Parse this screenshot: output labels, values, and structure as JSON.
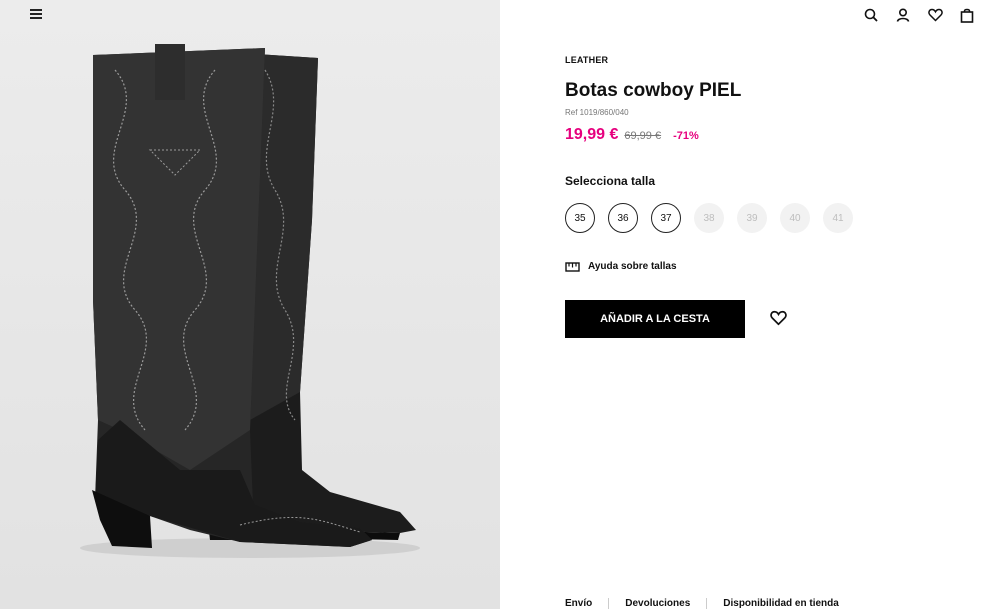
{
  "product": {
    "tag": "LEATHER",
    "title": "Botas cowboy PIEL",
    "ref": "Ref 1019/860/040",
    "price": "19,99 €",
    "old_price": "69,99 €",
    "discount": "-71%"
  },
  "sizes": {
    "label": "Selecciona talla",
    "options": [
      {
        "value": "35",
        "available": true
      },
      {
        "value": "36",
        "available": true
      },
      {
        "value": "37",
        "available": true
      },
      {
        "value": "38",
        "available": false
      },
      {
        "value": "39",
        "available": false
      },
      {
        "value": "40",
        "available": false
      },
      {
        "value": "41",
        "available": false
      }
    ]
  },
  "help": {
    "label": "Ayuda sobre tallas",
    "icon": "ruler-icon"
  },
  "actions": {
    "add_to_cart": "AÑADIR A LA CESTA",
    "wishlist_icon": "heart-icon"
  },
  "header": {
    "icons": [
      "search-icon",
      "user-icon",
      "heart-icon",
      "bag-icon"
    ],
    "menu_icon": "menu-icon"
  },
  "footer": {
    "links": [
      "Envío",
      "Devoluciones",
      "Disponibilidad en tienda"
    ]
  },
  "colors": {
    "accent": "#e6007e",
    "button": "#000000"
  }
}
